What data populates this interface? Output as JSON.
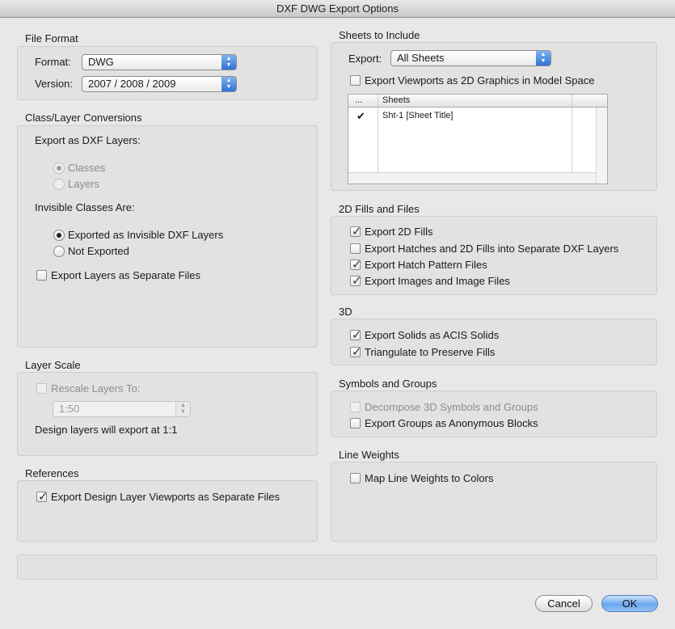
{
  "window": {
    "title": "DXF DWG Export Options"
  },
  "file_format": {
    "title": "File Format",
    "format_label": "Format:",
    "format_value": "DWG",
    "version_label": "Version:",
    "version_value": "2007 / 2008 / 2009"
  },
  "class_layer": {
    "title": "Class/Layer Conversions",
    "export_as_label": "Export as DXF Layers:",
    "classes_label": "Classes",
    "layers_label": "Layers",
    "invisible_label": "Invisible Classes Are:",
    "exported_invisible_label": "Exported as Invisible DXF Layers",
    "not_exported_label": "Not Exported",
    "separate_files_label": "Export Layers as Separate Files"
  },
  "layer_scale": {
    "title": "Layer Scale",
    "rescale_label": "Rescale Layers To:",
    "scale_value": "1:50",
    "note": "Design layers will export at 1:1"
  },
  "references": {
    "title": "References",
    "viewports_label": "Export Design Layer Viewports as Separate Files"
  },
  "sheets": {
    "title": "Sheets to Include",
    "export_label": "Export:",
    "export_value": "All Sheets",
    "viewports_2d_label": "Export Viewports as 2D Graphics in Model Space",
    "table": {
      "col_check_header": "...",
      "col_name_header": "Sheets",
      "rows": [
        {
          "check": "✔",
          "name": "Sht-1 [Sheet Title]"
        }
      ]
    }
  },
  "fills_files": {
    "title": "2D Fills and Files",
    "export_2d_fills": "Export 2D Fills",
    "export_hatches": "Export Hatches and 2D Fills into Separate DXF Layers",
    "export_hatch_pattern": "Export Hatch Pattern Files",
    "export_images": "Export Images and Image Files"
  },
  "three_d": {
    "title": "3D",
    "solids_label": "Export Solids as ACIS Solids",
    "triangulate_label": "Triangulate to Preserve Fills"
  },
  "symbols": {
    "title": "Symbols and Groups",
    "decompose_label": "Decompose 3D Symbols and Groups",
    "anonymous_label": "Export Groups as Anonymous Blocks"
  },
  "line_weights": {
    "title": "Line Weights",
    "map_label": "Map Line Weights to Colors"
  },
  "buttons": {
    "cancel": "Cancel",
    "ok": "OK"
  },
  "icons": {
    "popup_arrows": "⏶⏷"
  }
}
